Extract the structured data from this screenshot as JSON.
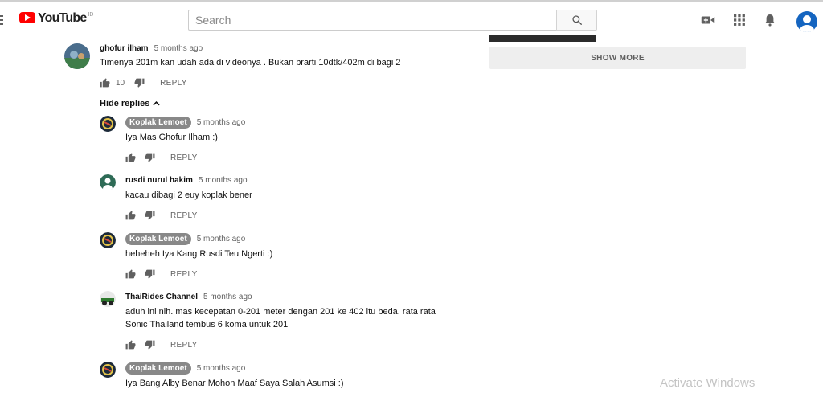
{
  "header": {
    "logo_text": "YouTube",
    "region": "ID",
    "search_placeholder": "Search"
  },
  "sidebar": {
    "show_more_label": "SHOW MORE"
  },
  "main_comment": {
    "author": "ghofur ilham",
    "time": "5 months ago",
    "text": "Timenya 201m kan udah ada di videonya . Bukan brarti 10dtk/402m di bagi 2",
    "likes": "10",
    "reply_label": "REPLY"
  },
  "hide_replies_label": "Hide replies",
  "replies": [
    {
      "author": "Koplak Lemoet",
      "time": "5 months ago",
      "text": "Iya Mas Ghofur Ilham :)",
      "reply_label": "REPLY"
    },
    {
      "author": "rusdi nurul hakim",
      "time": "5 months ago",
      "text": "kacau dibagi 2 euy koplak bener",
      "reply_label": "REPLY"
    },
    {
      "author": "Koplak Lemoet",
      "time": "5 months ago",
      "text": "heheheh Iya Kang Rusdi Teu Ngerti :)",
      "reply_label": "REPLY"
    },
    {
      "author": "ThaiRides Channel",
      "time": "5 months ago",
      "text_line1": "aduh ini nih. mas kecepatan 0-201 meter dengan 201 ke 402 itu beda. rata rata",
      "text_line2": "Sonic Thailand tembus 6 koma untuk 201",
      "reply_label": "REPLY"
    },
    {
      "author": "Koplak Lemoet",
      "time": "5 months ago",
      "text": "Iya Bang Alby Benar Mohon Maaf Saya Salah Asumsi :)"
    }
  ],
  "watermark": "Activate Windows",
  "colors": {
    "brand_red": "#ff0000",
    "avatar_blue": "#1565c0",
    "badge_gray": "#888888",
    "secondary_text": "#606060"
  },
  "icons": [
    "menu-icon",
    "youtube-logo-icon",
    "search-icon",
    "create-video-icon",
    "apps-icon",
    "notifications-icon",
    "account-avatar",
    "thumb-up-icon",
    "thumb-down-icon",
    "chevron-up-icon"
  ]
}
